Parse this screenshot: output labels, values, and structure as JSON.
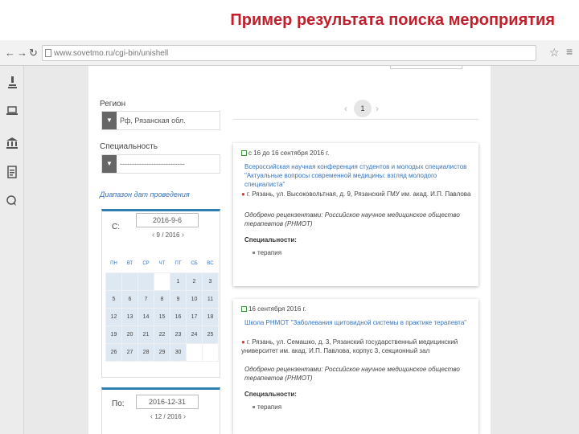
{
  "slide": {
    "title": "Пример результата поиска мероприятия"
  },
  "browser": {
    "url": "www.sovetmo.ru/cgi-bin/unishell",
    "back_icon": "arrow-left",
    "forward_icon": "arrow-right",
    "reload_icon": "reload",
    "star_icon": "star",
    "menu_icon": "menu"
  },
  "sidebar": {
    "icons": [
      "microscope-icon",
      "laptop-icon",
      "institution-icon",
      "document-icon",
      "chat-icon"
    ]
  },
  "filters": {
    "region_label": "Регион",
    "region_value": "Рф, Рязанская обл.",
    "specialty_label": "Специальность",
    "specialty_value": "---------------------------",
    "dates_label": "Диапазон дат проведения",
    "from_label": "С:",
    "from_value": "2016-9-6",
    "from_month": "9 / 2016",
    "to_label": "По:",
    "to_value": "2016-12-31",
    "to_month": "12 / 2016",
    "weekdays": [
      "ПН",
      "ВТ",
      "СР",
      "ЧТ",
      "ПТ",
      "СБ",
      "ВС"
    ],
    "weeks": [
      [
        "",
        "",
        "",
        "",
        "1",
        "2",
        "3",
        "4"
      ],
      [
        "5",
        "6",
        "7",
        "8",
        "9",
        "10",
        "11"
      ],
      [
        "12",
        "13",
        "14",
        "15",
        "16",
        "17",
        "18"
      ],
      [
        "19",
        "20",
        "21",
        "22",
        "23",
        "24",
        "25"
      ],
      [
        "26",
        "27",
        "28",
        "29",
        "30",
        "",
        ""
      ]
    ]
  },
  "pager": {
    "current": "1"
  },
  "results": [
    {
      "date": "с 16 до 16 сентября 2016 г.",
      "title": "Всероссийская научная конференция студентов и молодых специалистов \"Актуальные вопросы современной медицины: взгляд молодого специалиста\"",
      "address": "г. Рязань, ул. Высоковольтная, д. 9, Рязанский ГМУ им. акад. И.П. Павлова",
      "reviewed": "Одобрено рецензентами: Российское научное медицинское общество терапевтов (РНМОТ)",
      "spec_label": "Специальности:",
      "specs": [
        "терапия"
      ]
    },
    {
      "date": "16 сентября 2016 г.",
      "title": "Школа РНМОТ \"Заболевания щитовидной системы в практике терапевта\"",
      "address": "г. Рязань, ул. Семашко, д. 3, Рязанский государственный медицинский университет им. акад. И.П. Павлова, корпус 3, секционный зал",
      "reviewed": "Одобрено рецензентами: Российское научное медицинское общество терапевтов (РНМОТ)",
      "spec_label": "Специальности:",
      "specs": [
        "терапия"
      ]
    }
  ]
}
